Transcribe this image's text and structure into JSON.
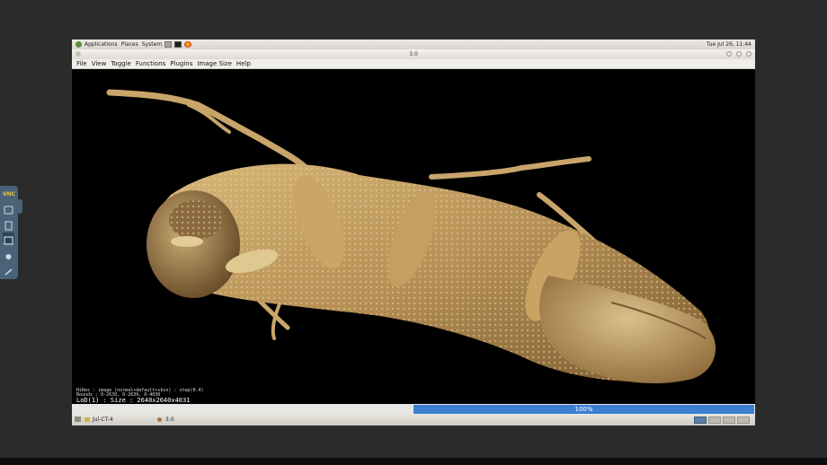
{
  "topbar": {
    "menus": [
      "Applications",
      "Places",
      "System"
    ],
    "clock": "Tue Jul 26, 11:44"
  },
  "window": {
    "title": "3.0"
  },
  "menubar": [
    "File",
    "View",
    "Toggle",
    "Functions",
    "Plugins",
    "Image Size",
    "Help"
  ],
  "overlay": {
    "line1": "HiRes : image (normal+default+skin) : step(0.4)",
    "line2": "Bounds : 0-2639, 0-2639, 0-4030",
    "line3": "LoD(1) : Size : 2640x2640x4031"
  },
  "progress": {
    "value": 1.0,
    "label": "100%"
  },
  "taskbar": {
    "item1": "Jul-CT-4",
    "item2": "3.0"
  },
  "vnc": {
    "logo": "VNC"
  },
  "colors": {
    "progress": "#3a7fd0",
    "specimen": "#c9a56a",
    "vnc_panel": "#4a6378"
  }
}
